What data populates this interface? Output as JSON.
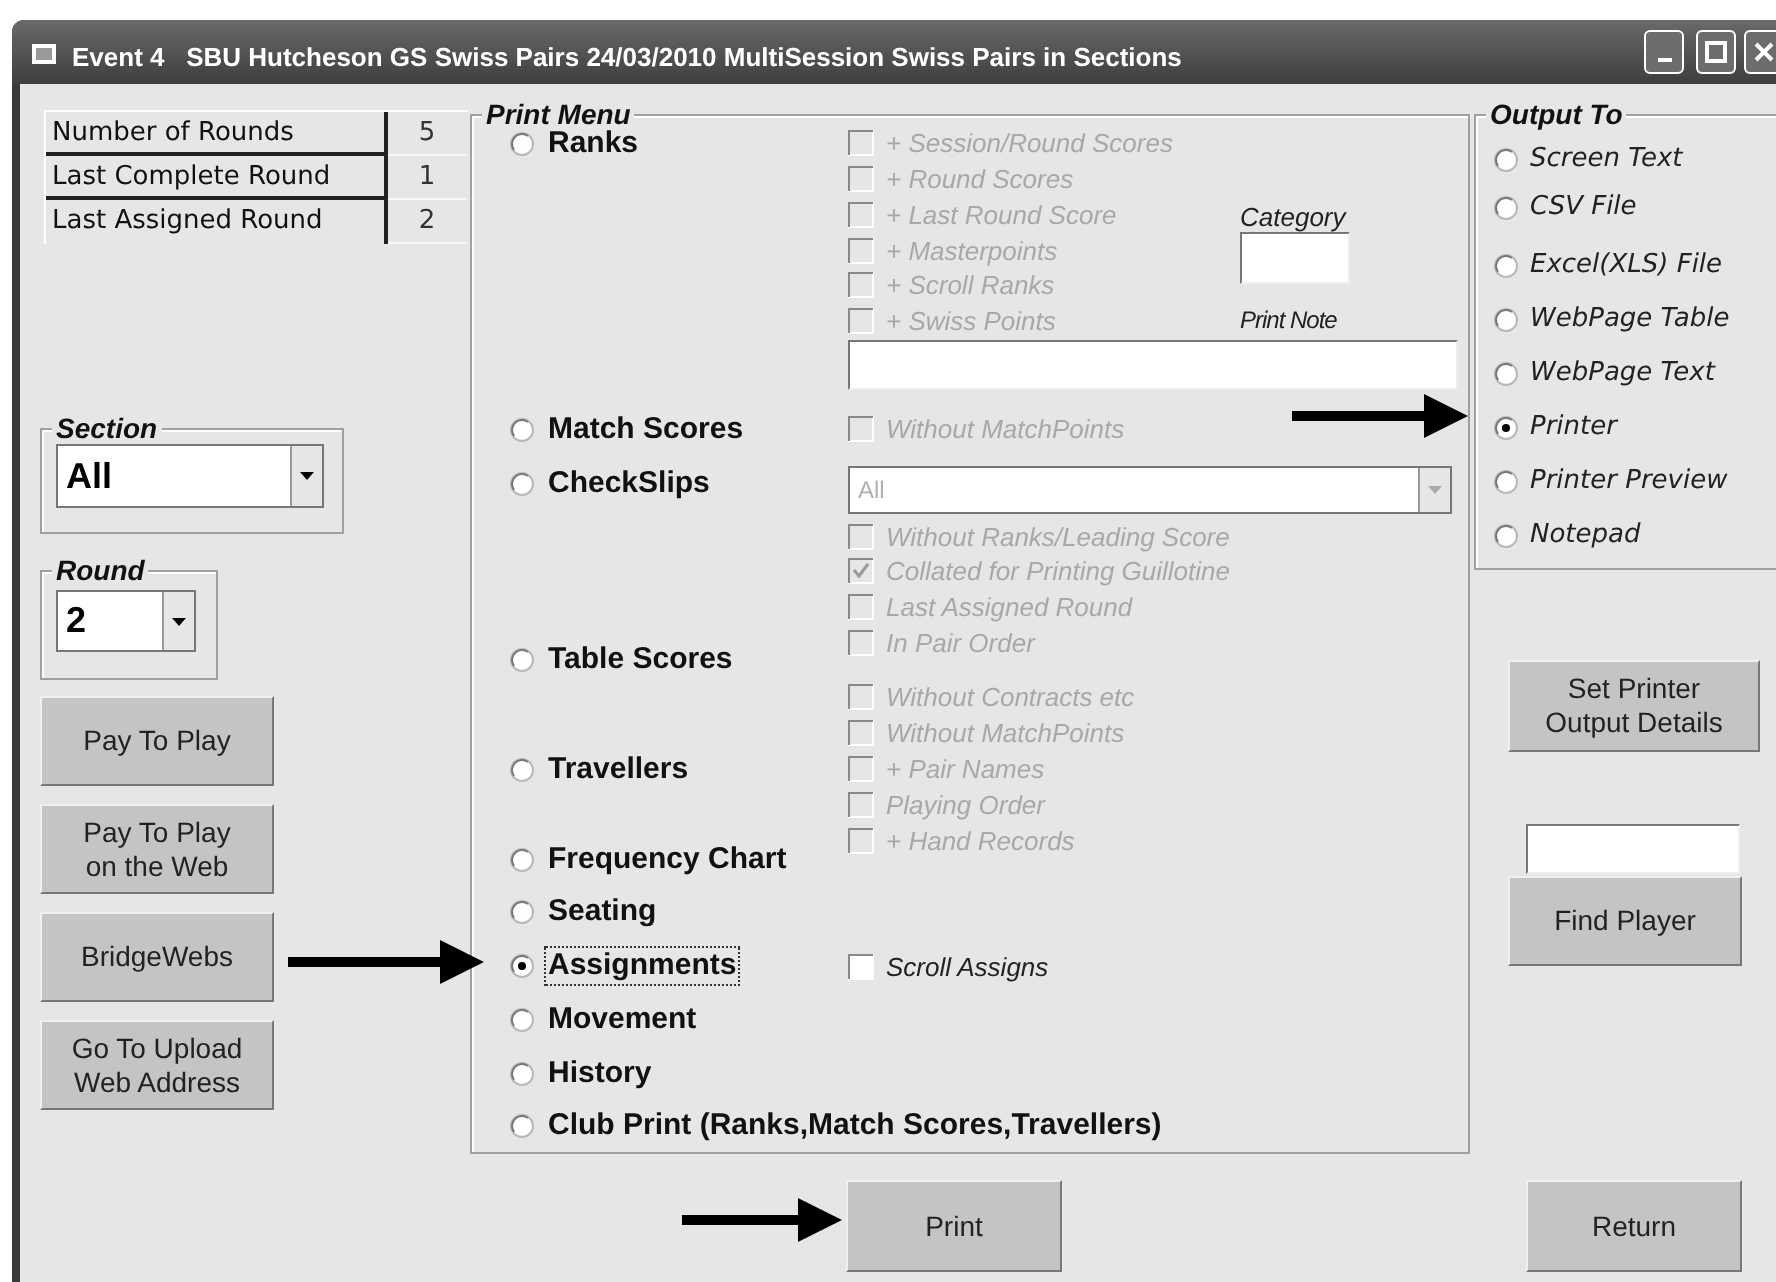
{
  "window": {
    "title": "Event 4   SBU Hutcheson GS Swiss Pairs 24/03/2010 MultiSession Swiss Pairs in Sections"
  },
  "info_table": [
    {
      "label": "Number of Rounds",
      "value": "5"
    },
    {
      "label": "Last Complete Round",
      "value": "1"
    },
    {
      "label": "Last Assigned Round",
      "value": "2"
    }
  ],
  "section": {
    "label": "Section",
    "value": "All"
  },
  "round": {
    "label": "Round",
    "value": "2"
  },
  "left_buttons": [
    "Pay To Play",
    "Pay To Play\non the Web",
    "BridgeWebs",
    "Go To Upload\nWeb Address"
  ],
  "print_menu": {
    "title": "Print Menu",
    "options": [
      {
        "label": "Ranks",
        "selected": false
      },
      {
        "label": "Match Scores",
        "selected": false
      },
      {
        "label": "CheckSlips",
        "selected": false
      },
      {
        "label": "Table Scores",
        "selected": false
      },
      {
        "label": "Travellers",
        "selected": false
      },
      {
        "label": "Frequency Chart",
        "selected": false
      },
      {
        "label": "Seating",
        "selected": false
      },
      {
        "label": "Assignments",
        "selected": true
      },
      {
        "label": "Movement",
        "selected": false
      },
      {
        "label": "History",
        "selected": false
      },
      {
        "label": "Club Print (Ranks,Match Scores,Travellers)",
        "selected": false
      }
    ]
  },
  "ranks_options": [
    {
      "label": "+ Session/Round Scores",
      "checked": false,
      "disabled": true
    },
    {
      "label": "+ Round Scores",
      "checked": false,
      "disabled": true
    },
    {
      "label": "+ Last Round Score",
      "checked": false,
      "disabled": true
    },
    {
      "label": "+ Masterpoints",
      "checked": false,
      "disabled": true
    },
    {
      "label": "+ Scroll Ranks",
      "checked": false,
      "disabled": true
    },
    {
      "label": "+ Swiss Points",
      "checked": false,
      "disabled": true
    }
  ],
  "category": {
    "label": "Category"
  },
  "print_note": {
    "label": "Print Note"
  },
  "match_scores_options": [
    {
      "label": "Without MatchPoints",
      "checked": false,
      "disabled": true
    }
  ],
  "checkslips_dropdown": {
    "value": "All",
    "disabled": true
  },
  "checkslips_options": [
    {
      "label": "Without Ranks/Leading Score",
      "checked": false,
      "disabled": true
    },
    {
      "label": "Collated for Printing Guillotine",
      "checked": true,
      "disabled": true
    },
    {
      "label": "Last Assigned Round",
      "checked": false,
      "disabled": true
    },
    {
      "label": "In Pair Order",
      "checked": false,
      "disabled": true
    }
  ],
  "table_scores_options": [
    {
      "label": "Without Contracts etc",
      "checked": false,
      "disabled": true
    },
    {
      "label": "Without MatchPoints",
      "checked": false,
      "disabled": true
    },
    {
      "label": "+ Pair Names",
      "checked": false,
      "disabled": true
    },
    {
      "label": "Playing Order",
      "checked": false,
      "disabled": true
    },
    {
      "label": "+ Hand Records",
      "checked": false,
      "disabled": true
    }
  ],
  "assignments_options": [
    {
      "label": "Scroll Assigns",
      "checked": false,
      "disabled": false
    }
  ],
  "output_to": {
    "title": "Output To",
    "options": [
      {
        "label": "Screen Text",
        "selected": false
      },
      {
        "label": "CSV File",
        "selected": false
      },
      {
        "label": "Excel(XLS) File",
        "selected": false
      },
      {
        "label": "WebPage Table",
        "selected": false
      },
      {
        "label": "WebPage Text",
        "selected": false
      },
      {
        "label": "Printer",
        "selected": true
      },
      {
        "label": "Printer Preview",
        "selected": false
      },
      {
        "label": "Notepad",
        "selected": false
      }
    ]
  },
  "set_printer_button": "Set Printer\nOutput Details",
  "find_player_button": "Find Player",
  "print_button": "Print",
  "return_button": "Return"
}
